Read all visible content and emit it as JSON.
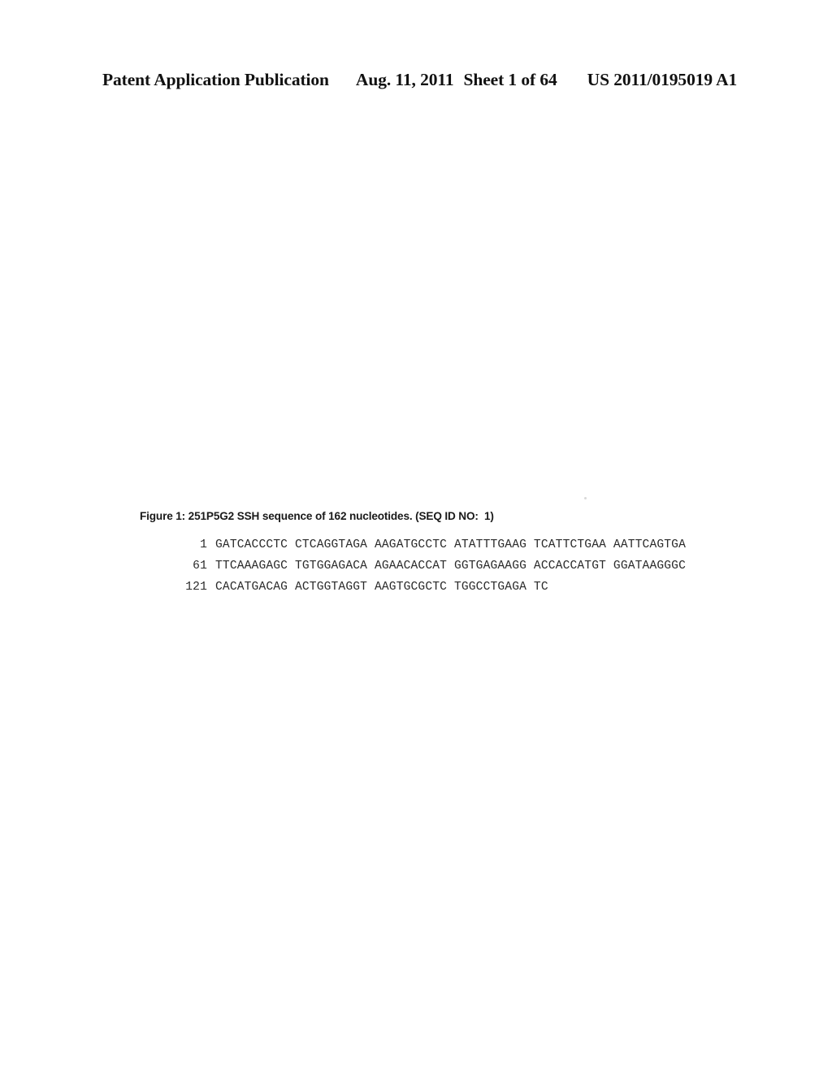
{
  "header": {
    "publication": "Patent Application Publication",
    "date": "Aug. 11, 2011",
    "sheet": "Sheet 1 of 64",
    "document_number": "US 2011/0195019 A1"
  },
  "figure": {
    "caption": "Figure 1: 251P5G2 SSH sequence of 162 nucleotides. (SEQ ID NO:  1)",
    "sequence_lines": [
      {
        "index": "1",
        "bases": "GATCACCCTC CTCAGGTAGA AAGATGCCTC ATATTTGAAG TCATTCTGAA AATTCAGTGA"
      },
      {
        "index": "61",
        "bases": "TTCAAAGAGC TGTGGAGACA AGAACACCAT GGTGAGAAGG ACCACCATGT GGATAAGGGC"
      },
      {
        "index": "121",
        "bases": "CACATGACAG ACTGGTAGGT AAGTGCGCTC TGGCCTGAGA TC"
      }
    ]
  }
}
